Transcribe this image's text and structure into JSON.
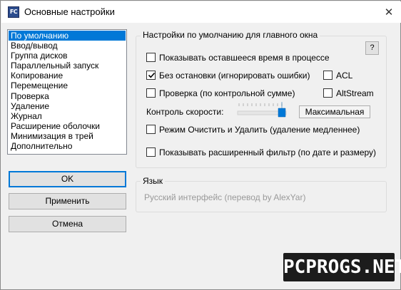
{
  "window": {
    "title": "Основные настройки",
    "icon_text": "FC",
    "close_glyph": "✕"
  },
  "sidebar": {
    "items": [
      {
        "label": "По умолчанию",
        "selected": true
      },
      {
        "label": "Ввод/вывод"
      },
      {
        "label": "Группа дисков"
      },
      {
        "label": "Параллельный запуск"
      },
      {
        "label": "Копирование"
      },
      {
        "label": "Перемещение"
      },
      {
        "label": "Проверка"
      },
      {
        "label": "Удаление"
      },
      {
        "label": "Журнал"
      },
      {
        "label": "Расширение оболочки"
      },
      {
        "label": "Минимизация в трей"
      },
      {
        "label": "Дополнительно"
      }
    ]
  },
  "buttons": {
    "ok": "OK",
    "apply": "Применить",
    "cancel": "Отмена"
  },
  "defaults_group": {
    "title": "Настройки по умолчанию для главного окна",
    "help_label": "?",
    "options": {
      "show_remaining": {
        "label": "Показывать оставшееся время в процессе",
        "checked": false
      },
      "no_stop": {
        "label": "Без остановки (игнорировать ошибки)",
        "checked": true
      },
      "acl": {
        "label": "ACL",
        "checked": false
      },
      "verify": {
        "label": "Проверка (по контрольной сумме)",
        "checked": false
      },
      "altstream": {
        "label": "AltStream",
        "checked": false
      },
      "clear_delete": {
        "label": "Режим Очистить и Удалить (удаление медленнее)",
        "checked": false
      },
      "extended_filter": {
        "label": "Показывать расширенный фильтр (по дате и размеру)",
        "checked": false
      }
    },
    "speed": {
      "label": "Контроль скорости:",
      "value": "Максимальная",
      "level": 1.0
    }
  },
  "language_group": {
    "title": "Язык",
    "value": "Русский интерфейс (перевод by AlexYar)"
  },
  "watermark": {
    "text": "PCPROGS.NET"
  },
  "icons": {
    "app": "fastcopy-app-icon",
    "close": "close-icon",
    "check": "checkmark-icon",
    "slider": "slider-thumb-icon"
  }
}
